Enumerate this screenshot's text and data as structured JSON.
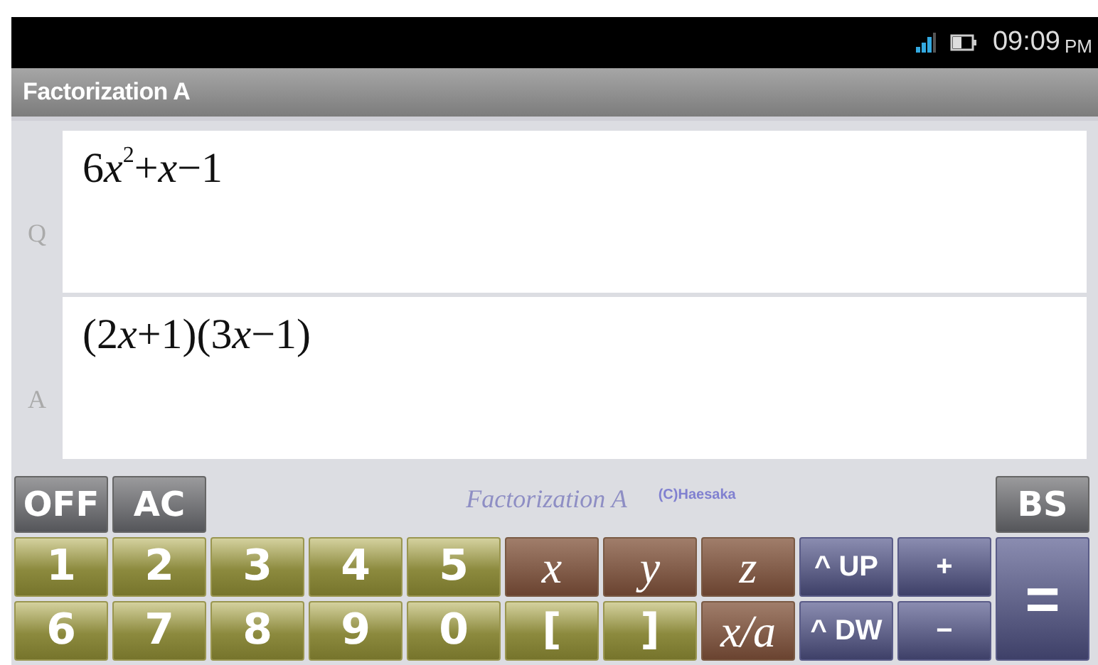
{
  "status_bar": {
    "time": "09:09",
    "ampm": "PM"
  },
  "title_bar": {
    "title": "Factorization A"
  },
  "rows": [
    {
      "label": "Q",
      "expression": [
        {
          "text": "6",
          "kind": "number"
        },
        {
          "text": "x",
          "kind": "variable"
        },
        {
          "text": "2",
          "kind": "exponent"
        },
        {
          "text": "+",
          "kind": "number"
        },
        {
          "text": "x",
          "kind": "variable"
        },
        {
          "text": "−1",
          "kind": "number"
        }
      ]
    },
    {
      "label": "A",
      "expression": [
        {
          "text": "(2",
          "kind": "number"
        },
        {
          "text": "x",
          "kind": "variable"
        },
        {
          "text": "+1)(3",
          "kind": "number"
        },
        {
          "text": "x",
          "kind": "variable"
        },
        {
          "text": "−1)",
          "kind": "number"
        }
      ]
    }
  ],
  "keypad": {
    "top_keys": [
      {
        "label": "OFF",
        "kind": "control"
      },
      {
        "label": "AC",
        "kind": "control"
      }
    ],
    "watermark": {
      "title": "Factorization A",
      "credit": "(C)Haesaka"
    },
    "side_key": {
      "label": "BS",
      "kind": "control"
    },
    "keys": [
      {
        "label": "1",
        "kind": "digit"
      },
      {
        "label": "2",
        "kind": "digit"
      },
      {
        "label": "3",
        "kind": "digit"
      },
      {
        "label": "4",
        "kind": "digit"
      },
      {
        "label": "5",
        "kind": "digit"
      },
      {
        "label": "x",
        "kind": "variable"
      },
      {
        "label": "y",
        "kind": "variable"
      },
      {
        "label": "z",
        "kind": "variable"
      },
      {
        "label": "^ UP",
        "kind": "operator"
      },
      {
        "label": "+",
        "kind": "operator"
      },
      {
        "label": "6",
        "kind": "digit"
      },
      {
        "label": "7",
        "kind": "digit"
      },
      {
        "label": "8",
        "kind": "digit"
      },
      {
        "label": "9",
        "kind": "digit"
      },
      {
        "label": "0",
        "kind": "digit"
      },
      {
        "label": "[",
        "kind": "digit"
      },
      {
        "label": "]",
        "kind": "digit"
      },
      {
        "label": "x/a",
        "kind": "variable"
      },
      {
        "label": "^ DW",
        "kind": "operator"
      },
      {
        "label": "−",
        "kind": "operator"
      }
    ],
    "equals_key": {
      "label": "=",
      "kind": "operator"
    }
  }
}
